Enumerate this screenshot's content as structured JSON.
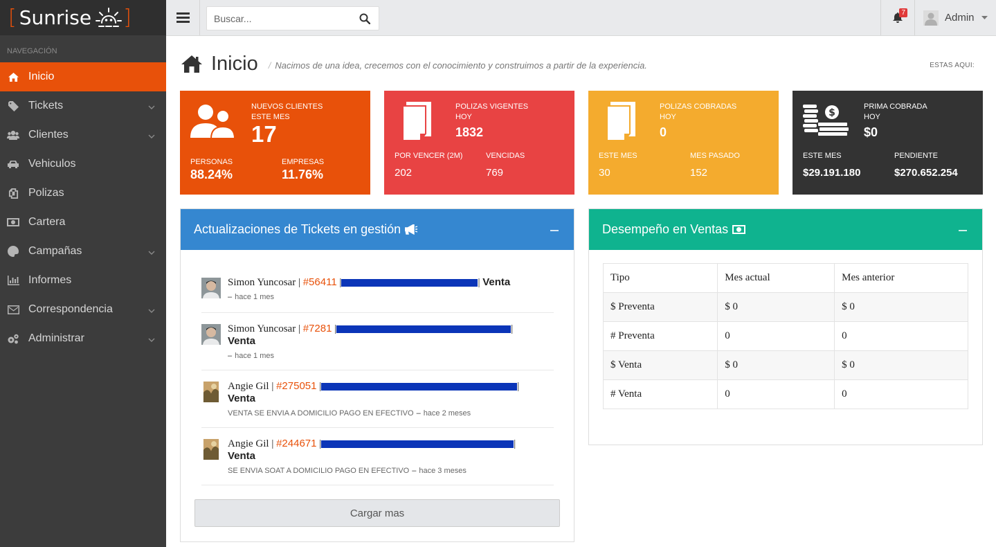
{
  "brand": {
    "name": "Sunrise",
    "bracket_left": "[",
    "bracket_right": "]",
    "accent": "#e8510a"
  },
  "sidebar": {
    "heading": "NAVEGACIÓN",
    "items": [
      {
        "label": "Inicio",
        "icon": "home-icon",
        "active": true
      },
      {
        "label": "Tickets",
        "icon": "tag-icon",
        "submenu": true
      },
      {
        "label": "Clientes",
        "icon": "users-icon",
        "submenu": true
      },
      {
        "label": "Vehiculos",
        "icon": "car-icon"
      },
      {
        "label": "Polizas",
        "icon": "copy-icon"
      },
      {
        "label": "Cartera",
        "icon": "money-icon"
      },
      {
        "label": "Campañas",
        "icon": "palette-icon",
        "submenu": true
      },
      {
        "label": "Informes",
        "icon": "bar-chart-icon"
      },
      {
        "label": "Correspondencia",
        "icon": "envelope-icon",
        "submenu": true
      },
      {
        "label": "Administrar",
        "icon": "gears-icon",
        "submenu": true
      }
    ]
  },
  "topbar": {
    "search_placeholder": "Buscar...",
    "notifications": "7",
    "user": "Admin"
  },
  "page": {
    "title": "Inicio",
    "subtitle": "Nacimos de una idea, crecemos con el conocimiento y construimos a partir de la experiencia.",
    "location_label": "ESTAS AQUI:"
  },
  "stats": [
    {
      "color": "#e8510a",
      "h1": "NUEVOS CLIENTES",
      "h2": "ESTE MES",
      "value": "17",
      "l1": "PERSONAS",
      "v1": "88.24%",
      "l2": "EMPRESAS",
      "v2": "11.76%"
    },
    {
      "color": "#e84343",
      "h1": "POLIZAS VIGENTES",
      "h2": "HOY",
      "value": "1832",
      "l1": "POR VENCER (2M)",
      "v1": "202",
      "l2": "VENCIDAS",
      "v2": "769"
    },
    {
      "color": "#f4ab2e",
      "h1": "POLIZAS COBRADAS",
      "h2": "HOY",
      "value": "0",
      "l1": "ESTE MES",
      "v1": "30",
      "l2": "MES PASADO",
      "v2": "152"
    },
    {
      "color": "#333333",
      "h1": "PRIMA COBRADA",
      "h2": "HOY",
      "value": "$0",
      "l1": "ESTE MES",
      "v1": "$29.191.180",
      "l2": "PENDIENTE",
      "v2": "$270.652.254"
    }
  ],
  "tickets_panel": {
    "title": "Actualizaciones de Tickets en gestión",
    "items": [
      {
        "user": "Simon Yuncosar",
        "number": "#56411",
        "type": "Venta",
        "note": "",
        "time": "hace 1 mes"
      },
      {
        "user": "Simon Yuncosar",
        "number": "#7281",
        "type": "Venta",
        "note": "",
        "time": "hace 1 mes"
      },
      {
        "user": "Angie Gil",
        "number": "#275051",
        "type": "Venta",
        "note": "VENTA SE ENVIA A DOMICILIO PAGO EN EFECTIVO",
        "time": "hace 2 meses"
      },
      {
        "user": "Angie Gil",
        "number": "#244671",
        "type": "Venta",
        "note": "SE ENVIA SOAT A DOMICILIO PAGO EN EFECTIVO",
        "time": "hace 3 meses"
      }
    ],
    "load_more": "Cargar mas"
  },
  "ventas_panel": {
    "title": "Desempeño en Ventas",
    "headers": [
      "Tipo",
      "Mes actual",
      "Mes anterior"
    ],
    "rows": [
      [
        "$ Preventa",
        "$ 0",
        "$ 0"
      ],
      [
        "# Preventa",
        "0",
        "0"
      ],
      [
        "$ Venta",
        "$ 0",
        "$ 0"
      ],
      [
        "# Venta",
        "0",
        "0"
      ]
    ]
  }
}
